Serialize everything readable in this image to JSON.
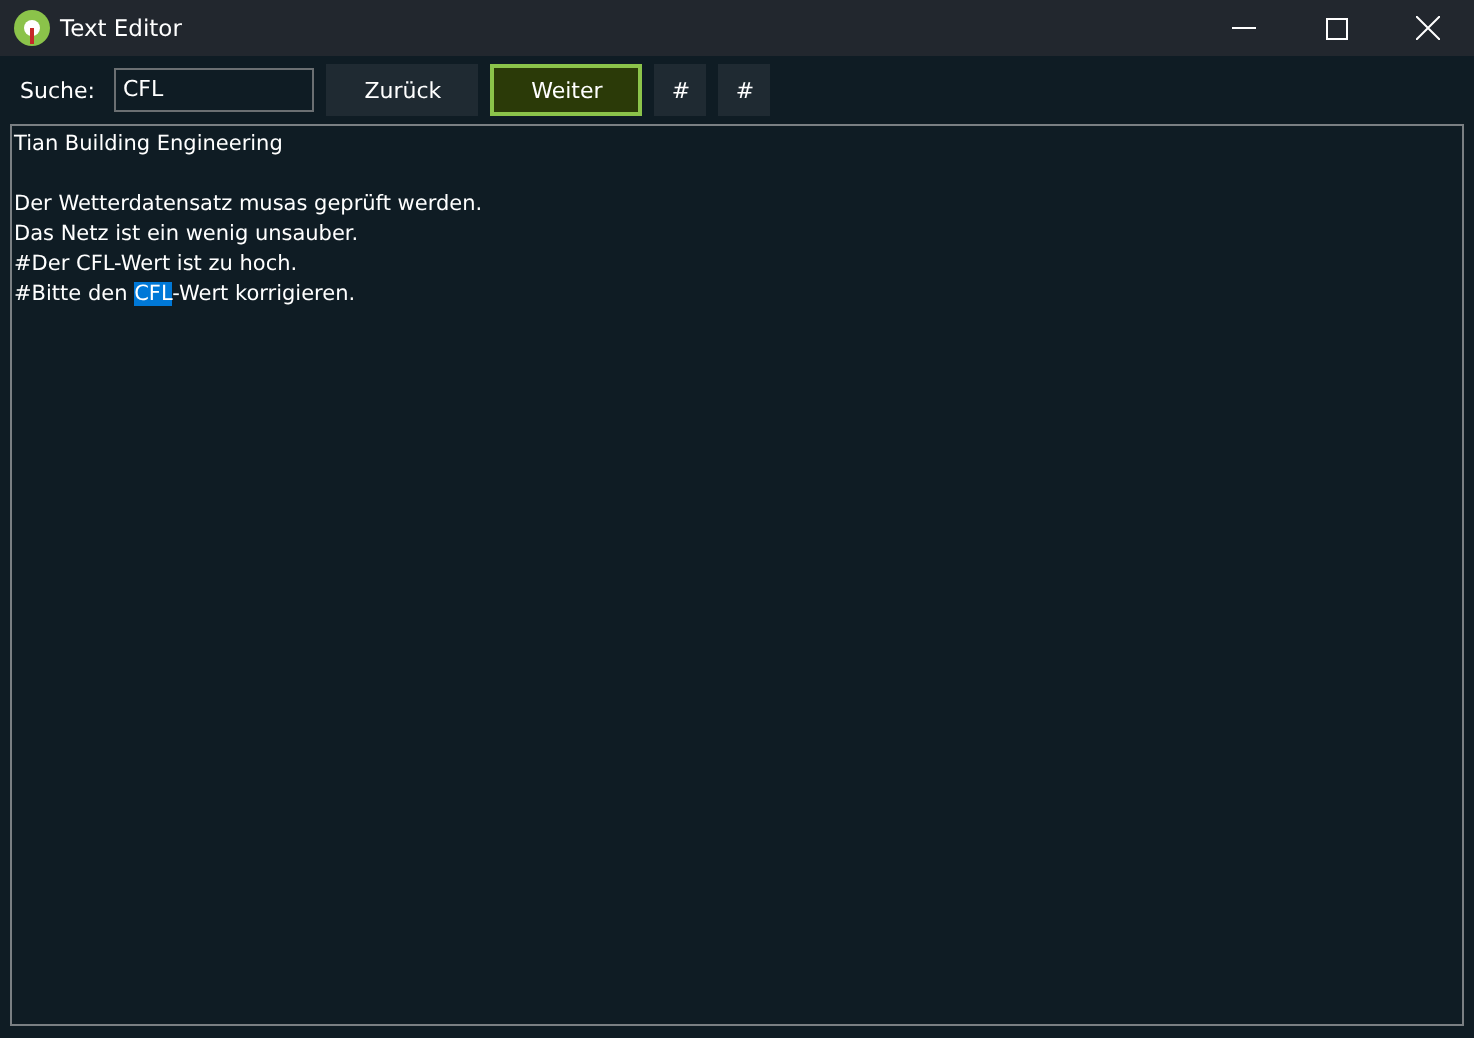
{
  "window": {
    "title": "Text Editor"
  },
  "search": {
    "label": "Suche:",
    "value": "CFL"
  },
  "buttons": [
    {
      "label": "Zurück",
      "focused": false
    },
    {
      "label": "Weiter",
      "focused": true
    },
    {
      "label": "#",
      "focused": false
    },
    {
      "label": "#",
      "focused": false
    }
  ],
  "editor": {
    "paragraphs": [
      [
        {
          "kind": "plain",
          "text": "Tian Building Engineering"
        }
      ],
      [
        {
          "kind": "plain",
          "text": "Der Wetterdatensatz musas geprüft werden."
        },
        {
          "kind": "plain",
          "text": "Das Netz ist ein wenig unsauber."
        },
        {
          "kind": "plain",
          "text": "#Der CFL-Wert ist zu hoch."
        },
        {
          "kind": "match",
          "before": "#Bitte den ",
          "match": "CFL",
          "after": "-Wert korrigieren."
        }
      ]
    ]
  }
}
